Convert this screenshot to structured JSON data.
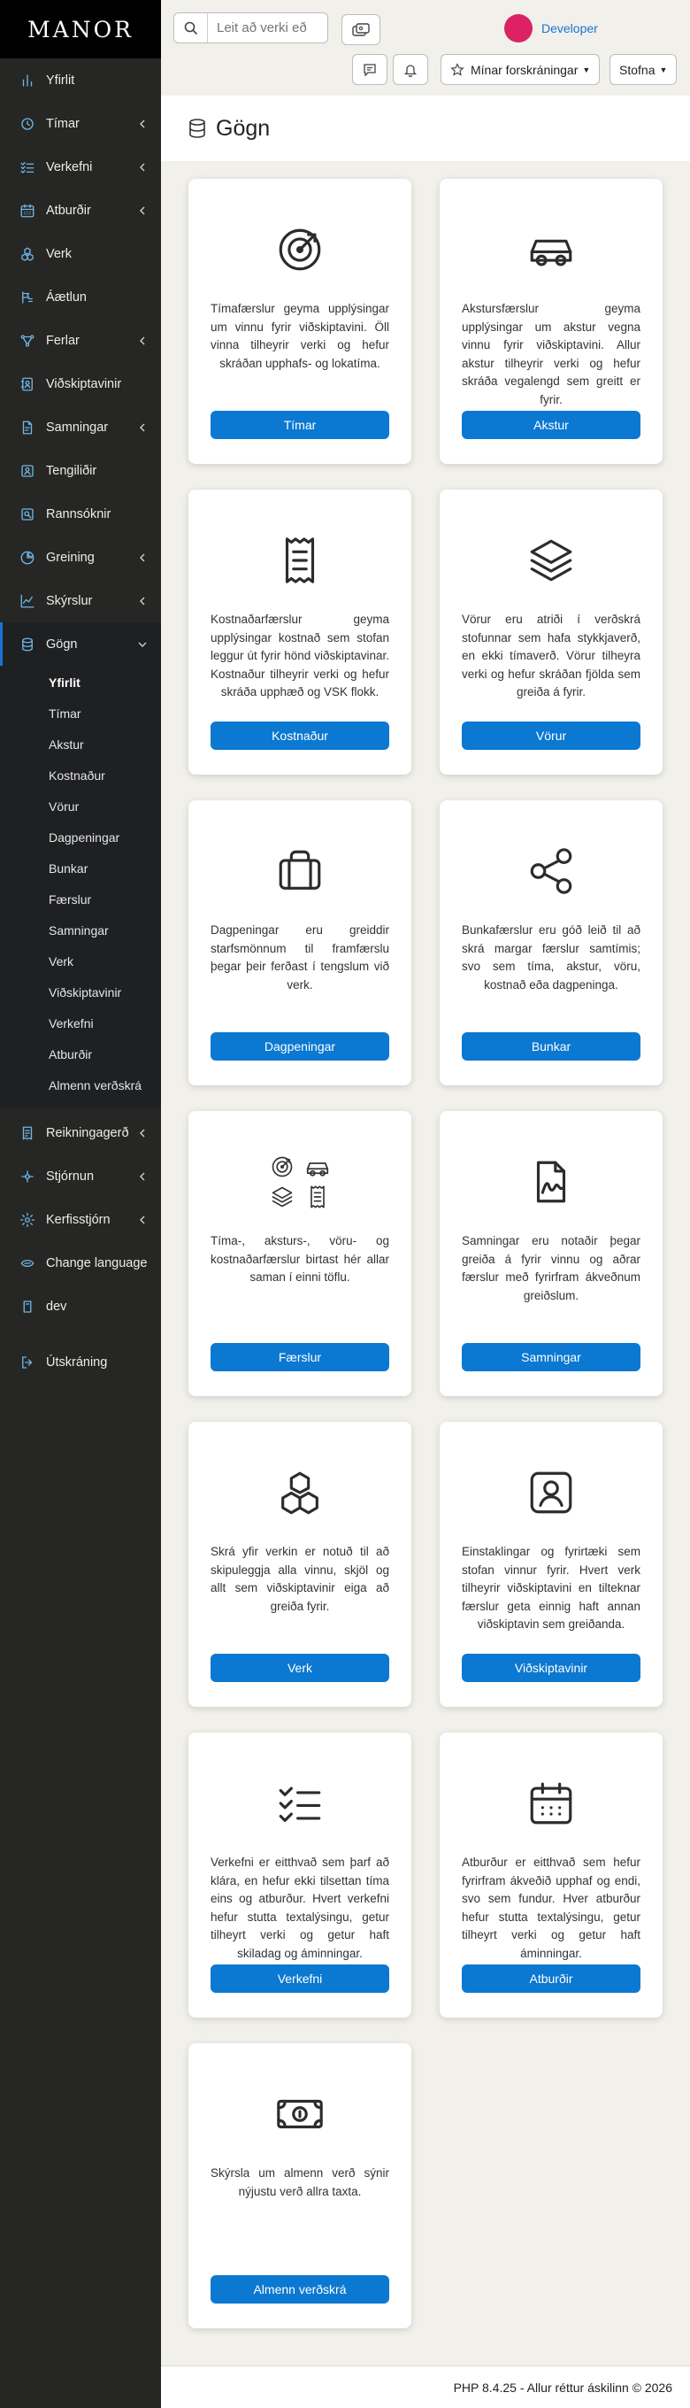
{
  "app": {
    "logo": "MANOR"
  },
  "sidebar": {
    "items": [
      {
        "label": "Yfirlit",
        "icon": "dashboard-icon"
      },
      {
        "label": "Tímar",
        "icon": "clock-icon",
        "has_children": true
      },
      {
        "label": "Verkefni",
        "icon": "list-check-icon",
        "has_children": true
      },
      {
        "label": "Atburðir",
        "icon": "calendar-icon",
        "has_children": true
      },
      {
        "label": "Verk",
        "icon": "cubes-icon"
      },
      {
        "label": "Áætlun",
        "icon": "plan-icon"
      },
      {
        "label": "Ferlar",
        "icon": "workflow-icon",
        "has_children": true
      },
      {
        "label": "Viðskiptavinir",
        "icon": "address-book-icon"
      },
      {
        "label": "Samningar",
        "icon": "contract-icon",
        "has_children": true
      },
      {
        "label": "Tengiliðir",
        "icon": "contacts-icon"
      },
      {
        "label": "Rannsóknir",
        "icon": "research-icon"
      },
      {
        "label": "Greining",
        "icon": "pie-chart-icon",
        "has_children": true
      },
      {
        "label": "Skýrslur",
        "icon": "line-chart-icon",
        "has_children": true
      },
      {
        "label": "Gögn",
        "icon": "database-icon",
        "has_children": true,
        "active": true
      }
    ],
    "gogn_sub": [
      "Yfirlit",
      "Tímar",
      "Akstur",
      "Kostnaður",
      "Vörur",
      "Dagpeningar",
      "Bunkar",
      "Færslur",
      "Samningar",
      "Verk",
      "Viðskiptavinir",
      "Verkefni",
      "Atburðir",
      "Almenn verðskrá"
    ],
    "gogn_sub_current": "Yfirlit",
    "bottom_items": [
      {
        "label": "Reikningagerð",
        "icon": "invoice-icon",
        "has_children": true
      },
      {
        "label": "Stjórnun",
        "icon": "settings-icon",
        "has_children": true
      },
      {
        "label": "Kerfisstjórn",
        "icon": "gear-icon",
        "has_children": true
      },
      {
        "label": "Change language",
        "icon": "language-icon"
      },
      {
        "label": "dev",
        "icon": "dev-icon"
      },
      {
        "label": "Útskráning",
        "icon": "logout-icon"
      }
    ]
  },
  "topbar": {
    "search_placeholder": "Leit að verki eð",
    "user_name": "Developer",
    "avatar_color": "#dc2262",
    "favorites_label": "Mínar forskráningar",
    "create_label": "Stofna"
  },
  "page": {
    "title": "Gögn"
  },
  "cards": [
    {
      "icon": "target-icon",
      "desc": "Tímafærslur geyma upplýsingar um vinnu fyrir viðskiptavini. Öll vinna tilheyrir verki og hefur skráðan upphafs- og lokatíma.",
      "button": "Tímar"
    },
    {
      "icon": "car-icon",
      "desc": "Akstursfærslur geyma upplýsingar um akstur vegna vinnu fyrir viðskiptavini. Allur akstur tilheyrir verki og hefur skráða vegalengd sem greitt er fyrir.",
      "button": "Akstur"
    },
    {
      "icon": "receipt-icon",
      "desc": "Kostnaðarfærslur geyma upplýsingar kostnað sem stofan leggur út fyrir hönd viðskiptavinar. Kostnaður tilheyrir verki og hefur skráða upphæð og VSK flokk.",
      "button": "Kostnaður"
    },
    {
      "icon": "layers-icon",
      "desc": "Vörur eru atriði í verðskrá stofunnar sem hafa stykkjaverð, en ekki tímaverð. Vörur tilheyra verki og hefur skráðan fjölda sem greiða á fyrir.",
      "button": "Vörur"
    },
    {
      "icon": "briefcase-icon",
      "desc": "Dagpeningar eru greiddir starfsmönnum til framfærslu þegar þeir ferðast í tengslum við verk.",
      "button": "Dagpeningar"
    },
    {
      "icon": "share-icon",
      "desc": "Bunkafærslur eru góð leið til að skrá margar færslur samtímis; svo sem tíma, akstur, vöru, kostnað eða dagpeninga.",
      "button": "Bunkar"
    },
    {
      "icon": "entries-icon",
      "desc": "Tíma-, aksturs-, vöru- og kostnaðarfærslur birtast hér allar saman í einni töflu.",
      "button": "Færslur"
    },
    {
      "icon": "contract-doc-icon",
      "desc": "Samningar eru notaðir þegar greiða á fyrir vinnu og aðrar færslur með fyrirfram ákveðnum greiðslum.",
      "button": "Samningar"
    },
    {
      "icon": "cubes-icon",
      "desc": "Skrá yfir verkin er notuð til að skipuleggja alla vinnu, skjöl og allt sem viðskiptavinir eiga að greiða fyrir.",
      "button": "Verk"
    },
    {
      "icon": "id-card-icon",
      "desc": "Einstaklingar og fyrirtæki sem stofan vinnur fyrir. Hvert verk tilheyrir viðskiptavini en tilteknar færslur geta einnig haft annan viðskiptavin sem greiðanda.",
      "button": "Viðskiptavinir"
    },
    {
      "icon": "list-check-icon",
      "desc": "Verkefni er eitthvað sem þarf að klára, en hefur ekki tilsettan tíma eins og atburður. Hvert verkefni hefur stutta textalýsingu, getur tilheyrt verki og getur haft skiladag og áminningar.",
      "button": "Verkefni"
    },
    {
      "icon": "calendar-icon",
      "desc": "Atburður er eitthvað sem hefur fyrirfram ákveðið upphaf og endi, svo sem fundur. Hver atburður hefur stutta textalýsingu, getur tilheyrt verki og getur haft áminningar.",
      "button": "Atburðir"
    },
    {
      "icon": "money-icon",
      "desc": "Skýrsla um almenn verð sýnir nýjustu verð allra taxta.",
      "button": "Almenn verðskrá"
    }
  ],
  "footer": {
    "text": "PHP 8.4.25 - Allur réttur áskilinn © 2026"
  },
  "colors": {
    "accent": "#0b78d1",
    "sidebar_bg": "#262624",
    "page_bg": "#f1f0ea",
    "nav_icon": "#6fb6e6"
  }
}
